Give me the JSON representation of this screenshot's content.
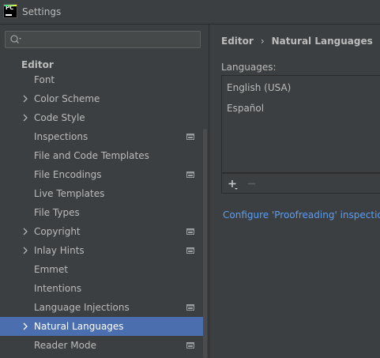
{
  "window": {
    "title": "Settings",
    "logo_text": "PC"
  },
  "search": {
    "placeholder": "",
    "value": ""
  },
  "sidebar": {
    "section": "Editor",
    "items": [
      {
        "label": "Font",
        "expandable": false,
        "project_icon": false,
        "selected": false
      },
      {
        "label": "Color Scheme",
        "expandable": true,
        "project_icon": false,
        "selected": false
      },
      {
        "label": "Code Style",
        "expandable": true,
        "project_icon": false,
        "selected": false
      },
      {
        "label": "Inspections",
        "expandable": false,
        "project_icon": true,
        "selected": false
      },
      {
        "label": "File and Code Templates",
        "expandable": false,
        "project_icon": false,
        "selected": false
      },
      {
        "label": "File Encodings",
        "expandable": false,
        "project_icon": true,
        "selected": false
      },
      {
        "label": "Live Templates",
        "expandable": false,
        "project_icon": false,
        "selected": false
      },
      {
        "label": "File Types",
        "expandable": false,
        "project_icon": false,
        "selected": false
      },
      {
        "label": "Copyright",
        "expandable": true,
        "project_icon": true,
        "selected": false
      },
      {
        "label": "Inlay Hints",
        "expandable": true,
        "project_icon": true,
        "selected": false
      },
      {
        "label": "Emmet",
        "expandable": false,
        "project_icon": false,
        "selected": false
      },
      {
        "label": "Intentions",
        "expandable": false,
        "project_icon": false,
        "selected": false
      },
      {
        "label": "Language Injections",
        "expandable": false,
        "project_icon": true,
        "selected": false
      },
      {
        "label": "Natural Languages",
        "expandable": true,
        "project_icon": false,
        "selected": true
      },
      {
        "label": "Reader Mode",
        "expandable": false,
        "project_icon": true,
        "selected": false
      }
    ]
  },
  "main": {
    "breadcrumb": [
      "Editor",
      "Natural Languages"
    ],
    "breadcrumb_separator": "›",
    "languages_label": "Languages:",
    "languages": [
      "English (USA)",
      "Español"
    ],
    "toolbar": {
      "add_icon": "plus-icon",
      "remove_icon": "minus-icon"
    },
    "configure_link": "Configure 'Proofreading' inspection..."
  },
  "colors": {
    "background": "#3c3f41",
    "selection": "#4b6eaf",
    "link": "#589df6",
    "text": "#bbbbbb"
  }
}
